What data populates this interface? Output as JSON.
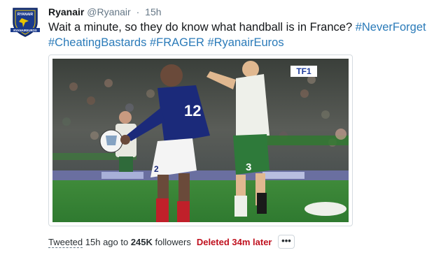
{
  "tweet": {
    "author_name": "Ryanair",
    "author_handle": "@Ryanair",
    "separator": "·",
    "time": "15h",
    "text_parts": [
      {
        "text": "Wait a minute, so they do know what handball is in France? ",
        "type": "text"
      },
      {
        "text": "#NeverForget",
        "type": "hashtag"
      },
      {
        "text": " ",
        "type": "text"
      },
      {
        "text": "#CheatingBastards",
        "type": "hashtag"
      },
      {
        "text": " ",
        "type": "text"
      },
      {
        "text": "#FRAGER",
        "type": "hashtag"
      },
      {
        "text": " ",
        "type": "text"
      },
      {
        "text": "#RyanairEuros",
        "type": "hashtag"
      }
    ]
  },
  "avatar": {
    "logo_text_top": "RYANAIR",
    "logo_text_bottom": "RYANAIREUROS"
  },
  "media": {
    "tv_logo": "TF1",
    "player_number_left": "12",
    "player_number_right": "3",
    "player_number_bottom": "2"
  },
  "footer": {
    "tweeted_label": "Tweeted",
    "ago_text": " 15h ago to ",
    "followers_count": "245K",
    "followers_label": " followers",
    "deleted_label": "Deleted 34m later",
    "more_label": "•••"
  },
  "colors": {
    "hashtag": "#2b7bb9",
    "deleted": "#c0111f",
    "brand_blue": "#1a3a8c",
    "brand_gold": "#e8c400"
  },
  "icons": {
    "avatar": "ryanair-crest-icon",
    "more": "more-dots-icon"
  }
}
